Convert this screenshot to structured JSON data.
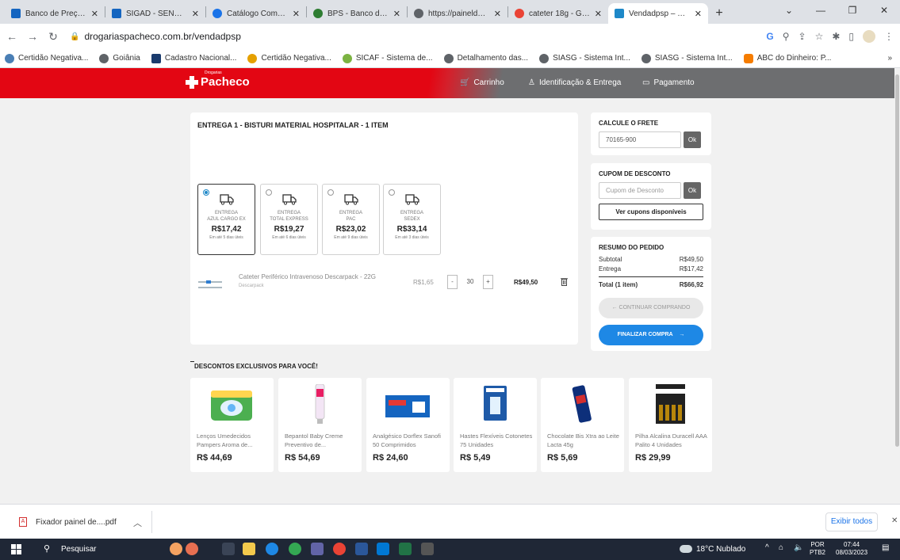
{
  "browser": {
    "tabs": [
      {
        "title": "Banco de Preços – ",
        "color": "#1565c0"
      },
      {
        "title": "SIGAD - SENADO F",
        "color": "#1565c0"
      },
      {
        "title": "Catálogo Compras",
        "color": "#1a73e8"
      },
      {
        "title": "BPS - Banco de Pre",
        "color": "#2e7d32"
      },
      {
        "title": "https://paineldepre",
        "color": "#5f6368"
      },
      {
        "title": "cateter 18g - Goog",
        "color": "#ea4335"
      },
      {
        "title": "Vendadpsp – Drog",
        "color": "#1e88c8"
      }
    ],
    "url": "drogariaspacheco.com.br/vendadpsp",
    "bookmarks": [
      {
        "label": "Certidão Negativa...",
        "color": "#4a7fb5"
      },
      {
        "label": "Goiânia",
        "color": "#5f6368"
      },
      {
        "label": "Cadastro Nacional...",
        "color": "#1a3b6d"
      },
      {
        "label": "Certidão Negativa...",
        "color": "#e5a000"
      },
      {
        "label": "SICAF - Sistema de...",
        "color": "#7cb342"
      },
      {
        "label": "Detalhamento das...",
        "color": "#5f6368"
      },
      {
        "label": "SIASG - Sistema Int...",
        "color": "#5f6368"
      },
      {
        "label": "SIASG - Sistema Int...",
        "color": "#5f6368"
      },
      {
        "label": "ABC do Dinheiro: P...",
        "color": "#f57c00"
      }
    ]
  },
  "header": {
    "logo": "Pacheco",
    "logo_small": "Drogarias",
    "steps": [
      "Carrinho",
      "Identificação & Entrega",
      "Pagamento"
    ]
  },
  "delivery": {
    "title": "ENTREGA 1 - BISTURI MATERIAL HOSPITALAR - 1 ITEM",
    "options": [
      {
        "line1": "ENTREGA",
        "line2": "AZUL CARGO EX",
        "price": "R$17,42",
        "eta": "Em até 5 dias úteis",
        "selected": true
      },
      {
        "line1": "ENTREGA",
        "line2": "TOTAL EXPRESS",
        "price": "R$19,27",
        "eta": "Em até 6 dias úteis",
        "selected": false
      },
      {
        "line1": "ENTREGA",
        "line2": "PAC",
        "price": "R$23,02",
        "eta": "Em até 9 dias úteis",
        "selected": false
      },
      {
        "line1": "ENTREGA",
        "line2": "SEDEX",
        "price": "R$33,14",
        "eta": "Em até 3 dias úteis",
        "selected": false
      }
    ]
  },
  "product": {
    "name": "Cateter Periférico Intravenoso Descarpack - 22G",
    "brand": "Descarpack",
    "unit_price": "R$1,65",
    "minus": "-",
    "qty": "30",
    "plus": "+",
    "total": "R$49,50"
  },
  "freight": {
    "title": "CALCULE O FRETE",
    "cep": "70165-900",
    "ok": "Ok"
  },
  "coupon": {
    "title": "CUPOM DE DESCONTO",
    "placeholder": "Cupom de Desconto",
    "ok": "Ok",
    "view": "Ver cupons disponíveis"
  },
  "summary": {
    "title": "RESUMO DO PEDIDO",
    "subtotal_label": "Subtotal",
    "subtotal": "R$49,50",
    "delivery_label": "Entrega",
    "delivery": "R$17,42",
    "total_label": "Total (1 item)",
    "total": "R$66,92",
    "continue": "← CONTINUAR COMPRANDO",
    "finish": "FINALIZAR COMPRA",
    "finish_arrow": "→"
  },
  "promos": {
    "title": "DESCONTOS EXCLUSIVOS PARA VOCÊ!",
    "items": [
      {
        "name": "Lenços Umedecidos Pampers Aroma de...",
        "price": "R$ 44,69"
      },
      {
        "name": "Bepantol Baby Creme Preventivo de...",
        "price": "R$ 54,69"
      },
      {
        "name": "Analgésico Dorflex Sanofi 50 Comprimidos",
        "price": "R$ 24,60"
      },
      {
        "name": "Hastes Flexíveis Cotonetes 75 Unidades",
        "price": "R$ 5,49"
      },
      {
        "name": "Chocolate Bis Xtra ao Leite Lacta 45g",
        "price": "R$ 5,69"
      },
      {
        "name": "Pilha Alcalina Duracell AAA Palito 4 Unidades",
        "price": "R$ 29,99"
      }
    ]
  },
  "download": {
    "file": "Fixador painel de....pdf",
    "show_all": "Exibir todos"
  },
  "taskbar": {
    "search": "Pesquisar",
    "weather": "18°C Nublado",
    "lang": "POR",
    "lang2": "PTB2",
    "time": "07:44",
    "date": "08/03/2023"
  }
}
